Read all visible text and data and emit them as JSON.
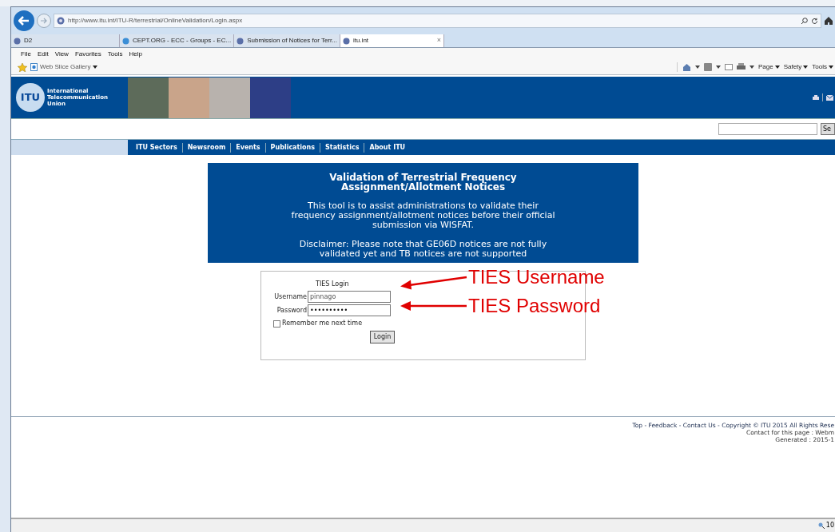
{
  "browser": {
    "url": "http://www.itu.int/ITU-R/terrestrial/OnlineValidation/Login.aspx",
    "tabs": [
      {
        "label": "D2",
        "selected": false
      },
      {
        "label": "CEPT.ORG - ECC - Groups - EC...",
        "selected": false
      },
      {
        "label": "Submission of Notices for Terr...",
        "selected": false
      },
      {
        "label": "itu.int",
        "selected": true,
        "close": "×"
      }
    ],
    "menu": [
      "File",
      "Edit",
      "View",
      "Favorites",
      "Tools",
      "Help"
    ],
    "favorites": [
      "Web Slice Gallery"
    ],
    "commands": [
      "Page",
      "Safety",
      "Tools"
    ]
  },
  "site": {
    "logo": "ITU",
    "org_name": [
      "International",
      "Telecommunication",
      "Union"
    ],
    "search_button": "Se",
    "nav": [
      "ITU Sectors",
      "Newsroom",
      "Events",
      "Publications",
      "Statistics",
      "About ITU"
    ]
  },
  "banner": {
    "title": "Validation of Terrestrial Frequency Assignment/Allotment Notices",
    "description": "This tool is to assist administrations to validate their frequency assignment/allotment notices before their official submission via WISFAT.",
    "disclaimer": "Disclaimer: Please note that GE06D notices are not fully validated yet and TB notices are not supported"
  },
  "login": {
    "title": "TIES Login",
    "username": {
      "label": "Username",
      "value": "pinnago"
    },
    "password": {
      "label": "Password",
      "value": "••••••••••"
    },
    "remember": {
      "label": "Remember me next time",
      "checked": false
    },
    "button": "Login"
  },
  "annotations": [
    {
      "text": "TIES Username"
    },
    {
      "text": "TIES Password"
    }
  ],
  "footer": {
    "links": "Top - Feedback - Contact Us -  Copyright © ITU 2015 All Rights Rese",
    "contact": "Contact for this page : Webm",
    "generated": "Generated : 2015-1"
  },
  "status_bar": {
    "zoom": "10"
  }
}
